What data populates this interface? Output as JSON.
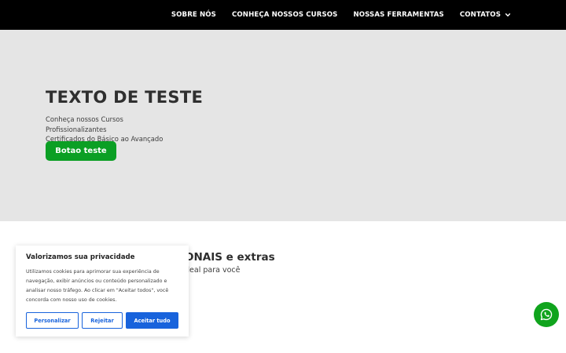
{
  "nav": {
    "items": [
      {
        "label": "SOBRE NÓS"
      },
      {
        "label": "CONHEÇA NOSSOS CURSOS"
      },
      {
        "label": "NOSSAS FERRAMENTAS"
      },
      {
        "label": "CONTATOS",
        "icon": "chevron-down-icon"
      }
    ]
  },
  "hero": {
    "title": "TEXTO DE TESTE",
    "subtitle_line1": "Conheça nossos Cursos Profissionalizantes",
    "subtitle_line2": "Certificados do Básico ao Avançado",
    "button_label": "Botao teste",
    "button_color": "#0b9f24",
    "background": "#e5e5e5"
  },
  "section": {
    "title_visible": "ONAIS e extras",
    "subtitle_visible": "deal para você"
  },
  "cookie_banner": {
    "title": "Valorizamos sua privacidade",
    "text": "Utilizamos cookies para aprimorar sua experiência de navegação, exibir anúncios ou conteúdo personalizado e analisar nosso tráfego. Ao clicar em \"Aceitar todos\", você concorda com nosso uso de cookies.",
    "buttons": {
      "customize": "Personalizar",
      "reject": "Rejeitar",
      "accept_all": "Aceitar tudo"
    },
    "accent_color": "#1863dc"
  },
  "whatsapp": {
    "icon": "whatsapp-icon",
    "color": "#10a41d"
  }
}
